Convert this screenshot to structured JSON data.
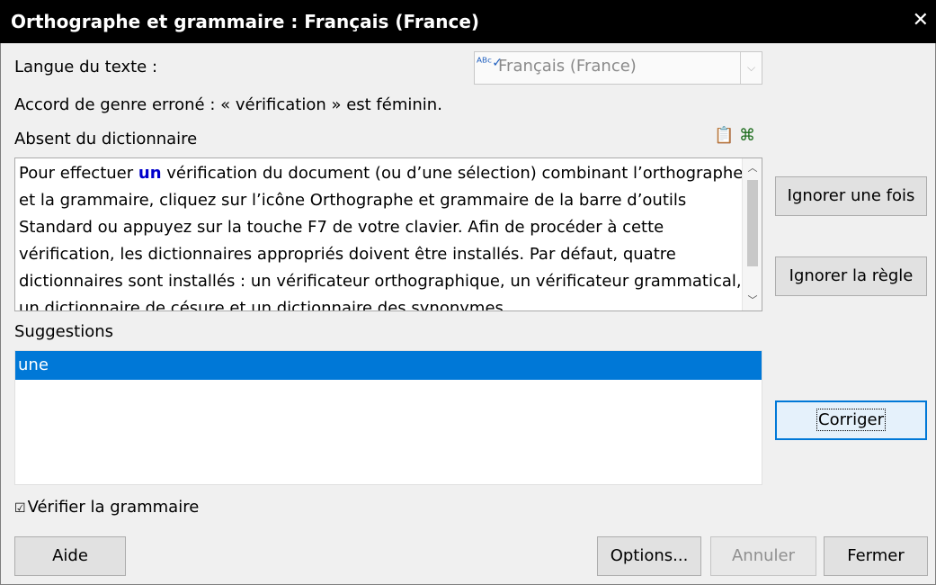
{
  "window": {
    "title": "Orthographe et grammaire : Français (France)",
    "close_glyph": "✕"
  },
  "language": {
    "label": "Langue du texte :",
    "value": "Français (France)",
    "icon": "spellcheck-icon",
    "arrow_glyph": "⌵"
  },
  "error_message": "Accord de genre erroné : « vérification » est féminin.",
  "not_in_dictionary_label": "Absent du dictionnaire",
  "toolbar_icons": [
    "paste-icon",
    "command-icon"
  ],
  "text": {
    "before": "Pour effectuer ",
    "error_word": "un",
    "after": " vérification du document (ou d’une sélection) combinant l’orthographe et la grammaire, cliquez sur l’icône Orthographe et grammaire de la barre d’outils Standard ou appuyez sur la touche F7 de votre clavier. Afin de procéder à cette vérification, les dictionnaires appropriés doivent être installés. Par défaut, quatre dictionnaires sont installés : un vérificateur orthographique, un vérificateur grammatical, un dictionnaire de césure et un dictionnaire des synonymes."
  },
  "suggestions": {
    "label": "Suggestions",
    "items": [
      "une"
    ],
    "selected_index": 0
  },
  "check_grammar": {
    "label": "Vérifier la grammaire",
    "checked": true
  },
  "buttons": {
    "ignore_once": "Ignorer une fois",
    "ignore_rule": "Ignorer la règle",
    "correct": "Corriger",
    "help": "Aide",
    "options": "Options...",
    "undo": "Annuler",
    "close": "Fermer"
  },
  "colors": {
    "error_word": "#0000cc",
    "selection": "#0078d7",
    "titlebar": "#000000"
  }
}
